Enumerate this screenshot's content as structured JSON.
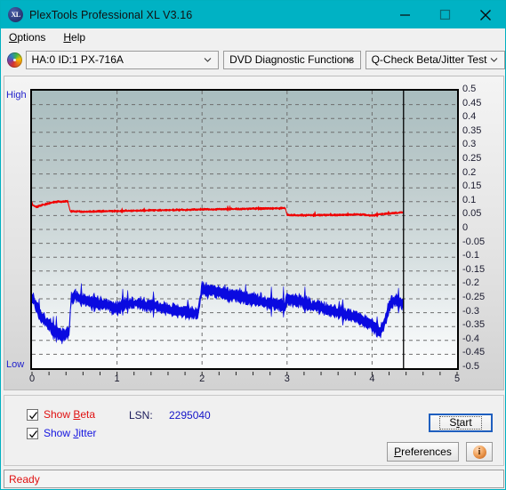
{
  "window": {
    "title": "PlexTools Professional XL V3.16",
    "app_icon": "xl-logo-icon",
    "accent_color": "#00b2c4",
    "minimize_label": "─",
    "maximize_label": "□",
    "close_label": "×"
  },
  "menu": {
    "items": [
      {
        "label": "Options",
        "accel": "O"
      },
      {
        "label": "Help",
        "accel": "H"
      }
    ]
  },
  "toolbar": {
    "disc_icon": "optical-disc-icon",
    "drive_select": {
      "value": "HA:0 ID:1  PX-716A",
      "options": [
        "HA:0 ID:1  PX-716A"
      ]
    },
    "function_select": {
      "value": "DVD Diagnostic Functions",
      "options": [
        "DVD Diagnostic Functions"
      ]
    },
    "test_select": {
      "value": "Q-Check Beta/Jitter Test",
      "options": [
        "Q-Check Beta/Jitter Test"
      ]
    }
  },
  "controls": {
    "show_beta": {
      "label_pre": "Show ",
      "label_accel": "B",
      "label_post": "eta",
      "checked": true,
      "color": "#e01010"
    },
    "show_jitter": {
      "label_pre": "Show ",
      "label_accel": "J",
      "label_post": "itter",
      "checked": true,
      "color": "#1414e0"
    },
    "lsn_label": "LSN:",
    "lsn_value": "2295040",
    "start_button": {
      "pre": "S",
      "accel": "t",
      "post": "art",
      "full": "Start"
    },
    "preferences_button": {
      "pre": "",
      "accel": "P",
      "post": "references",
      "full": "Preferences"
    },
    "info_button": {
      "label": "i",
      "name": "info-icon"
    }
  },
  "statusbar": {
    "text": "Ready",
    "color": "#e01010"
  },
  "chart_data": {
    "type": "line",
    "title": "Q-Check Beta/Jitter Test",
    "xlabel": "",
    "ylabel": "",
    "xlim": [
      0,
      5
    ],
    "ylim": [
      -0.5,
      0.5
    ],
    "grid": true,
    "legend_position": "bottom-left",
    "axis_left_labels": {
      "top": "High",
      "bottom": "Low"
    },
    "xticks": [
      0,
      1,
      2,
      3,
      4,
      5
    ],
    "xtick_labels": [
      "0",
      "1",
      "2",
      "3",
      "4",
      "5"
    ],
    "xminor_step": 0.2,
    "yticks": [
      0.5,
      0.45,
      0.4,
      0.35,
      0.3,
      0.25,
      0.2,
      0.15,
      0.1,
      0.05,
      0,
      -0.05,
      -0.1,
      -0.15,
      -0.2,
      -0.25,
      -0.3,
      -0.35,
      -0.4,
      -0.45,
      -0.5
    ],
    "ytick_labels": [
      "0.5",
      "0.45",
      "0.4",
      "0.35",
      "0.3",
      "0.25",
      "0.2",
      "0.15",
      "0.1",
      "0.05",
      "0",
      "-0.05",
      "-0.1",
      "-0.15",
      "-0.2",
      "-0.25",
      "-0.3",
      "-0.35",
      "-0.4",
      "-0.45",
      "-0.5"
    ],
    "data_end_marker_x": 4.37,
    "plot_bg_gradient": [
      "#a9bdbf",
      "#fbfcfd"
    ],
    "series": [
      {
        "name": "Beta",
        "color": "#f00000",
        "band_halfwidth": 0.006,
        "x": [
          0.0,
          0.05,
          0.1,
          0.15,
          0.2,
          0.25,
          0.3,
          0.35,
          0.4,
          0.42,
          0.45,
          0.5,
          0.6,
          0.7,
          0.8,
          0.9,
          0.99,
          1.0,
          1.1,
          1.25,
          1.4,
          1.55,
          1.7,
          1.85,
          2.0,
          2.1,
          2.2,
          2.3,
          2.4,
          2.5,
          2.6,
          2.7,
          2.8,
          2.9,
          2.98,
          3.0,
          3.1,
          3.25,
          3.4,
          3.55,
          3.7,
          3.85,
          4.0,
          4.1,
          4.2,
          4.3,
          4.37
        ],
        "y": [
          0.09,
          0.081,
          0.086,
          0.09,
          0.094,
          0.098,
          0.101,
          0.1,
          0.102,
          0.101,
          0.066,
          0.065,
          0.064,
          0.064,
          0.065,
          0.066,
          0.067,
          0.066,
          0.067,
          0.068,
          0.069,
          0.069,
          0.07,
          0.071,
          0.072,
          0.072,
          0.073,
          0.073,
          0.074,
          0.074,
          0.075,
          0.075,
          0.076,
          0.076,
          0.077,
          0.052,
          0.051,
          0.051,
          0.052,
          0.052,
          0.053,
          0.054,
          0.05,
          0.055,
          0.058,
          0.06,
          0.062
        ]
      },
      {
        "name": "Jitter",
        "color": "#0a0ae0",
        "band_halfwidth": 0.035,
        "x": [
          0.0,
          0.04,
          0.08,
          0.12,
          0.16,
          0.2,
          0.24,
          0.28,
          0.32,
          0.36,
          0.4,
          0.44,
          0.46,
          0.5,
          0.56,
          0.62,
          0.7,
          0.8,
          0.9,
          0.99,
          1.0,
          1.08,
          1.16,
          1.25,
          1.35,
          1.45,
          1.55,
          1.65,
          1.75,
          1.85,
          1.95,
          2.0,
          2.1,
          2.2,
          2.3,
          2.4,
          2.5,
          2.6,
          2.7,
          2.8,
          2.9,
          2.98,
          3.0,
          3.1,
          3.2,
          3.3,
          3.4,
          3.5,
          3.6,
          3.7,
          3.8,
          3.9,
          4.0,
          4.05,
          4.1,
          4.15,
          4.2,
          4.25,
          4.3,
          4.37
        ],
        "y": [
          -0.245,
          -0.27,
          -0.3,
          -0.32,
          -0.33,
          -0.345,
          -0.36,
          -0.37,
          -0.378,
          -0.38,
          -0.375,
          -0.365,
          -0.25,
          -0.24,
          -0.25,
          -0.258,
          -0.262,
          -0.268,
          -0.275,
          -0.282,
          -0.285,
          -0.27,
          -0.265,
          -0.268,
          -0.272,
          -0.278,
          -0.285,
          -0.29,
          -0.295,
          -0.3,
          -0.305,
          -0.215,
          -0.222,
          -0.228,
          -0.234,
          -0.24,
          -0.246,
          -0.252,
          -0.258,
          -0.264,
          -0.27,
          -0.276,
          -0.25,
          -0.258,
          -0.266,
          -0.274,
          -0.282,
          -0.29,
          -0.298,
          -0.306,
          -0.316,
          -0.328,
          -0.345,
          -0.358,
          -0.368,
          -0.33,
          -0.275,
          -0.255,
          -0.262,
          -0.27
        ]
      }
    ]
  }
}
